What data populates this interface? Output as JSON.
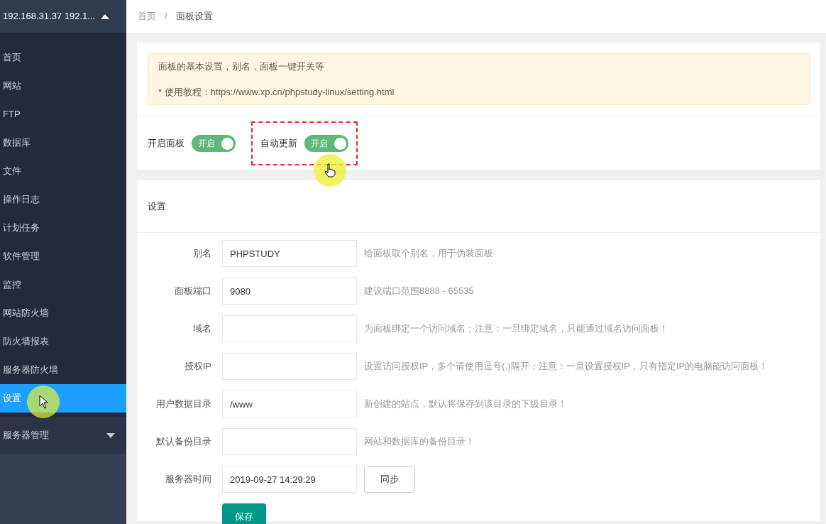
{
  "sidebar": {
    "header": {
      "title": "192.168.31.37 192.1...",
      "expanded": true
    },
    "items": [
      {
        "label": "首页",
        "selected": false
      },
      {
        "label": "网站",
        "selected": false
      },
      {
        "label": "FTP",
        "selected": false
      },
      {
        "label": "数据库",
        "selected": false
      },
      {
        "label": "文件",
        "selected": false
      },
      {
        "label": "操作日志",
        "selected": false
      },
      {
        "label": "计划任务",
        "selected": false
      },
      {
        "label": "软件管理",
        "selected": false
      },
      {
        "label": "监控",
        "selected": false
      },
      {
        "label": "网站防火墙",
        "selected": false
      },
      {
        "label": "防火墙报表",
        "selected": false
      },
      {
        "label": "服务器防火墙",
        "selected": false
      },
      {
        "label": "设置",
        "selected": true
      }
    ],
    "group": {
      "label": "服务器管理",
      "expanded": false
    }
  },
  "breadcrumb": {
    "items": [
      "首页",
      "面板设置"
    ],
    "separator": "/"
  },
  "notice": [
    "面板的基本设置，别名，面板一键开关等",
    "* 使用教程：https://www.xp.cn/phpstudy-linux/setting.html"
  ],
  "switches": [
    {
      "label": "开启面板",
      "text": "开启",
      "on": true,
      "highlighted": false
    },
    {
      "label": "自动更新",
      "text": "开启",
      "on": true,
      "highlighted": true
    }
  ],
  "settings": {
    "title": "设置",
    "fields": [
      {
        "label": "别名",
        "value": "PHPSTUDY",
        "hint": "给面板取个别名，用于伪装面板"
      },
      {
        "label": "面板端口",
        "value": "9080",
        "hint": "建议端口范围8888 - 65535"
      },
      {
        "label": "域名",
        "hint": "为面板绑定一个访问域名；注意：一旦绑定域名，只能通过域名访问面板！"
      },
      {
        "label": "授权IP",
        "hint": "设置访问授权IP，多个请使用逗号(,)隔开；注意：一旦设置授权IP，只有指定IP的电脑能访问面板！"
      },
      {
        "label": "用户数据目录",
        "value": "/www",
        "hint": "新创建的站点，默认将保存到该目录的下级目录！"
      },
      {
        "label": "默认备份目录",
        "hint": "网站和数据库的备份目录！"
      },
      {
        "label": "服务器时间",
        "value": "2019-09-27 14:29:29",
        "button": "同步"
      }
    ],
    "save": "保存"
  }
}
